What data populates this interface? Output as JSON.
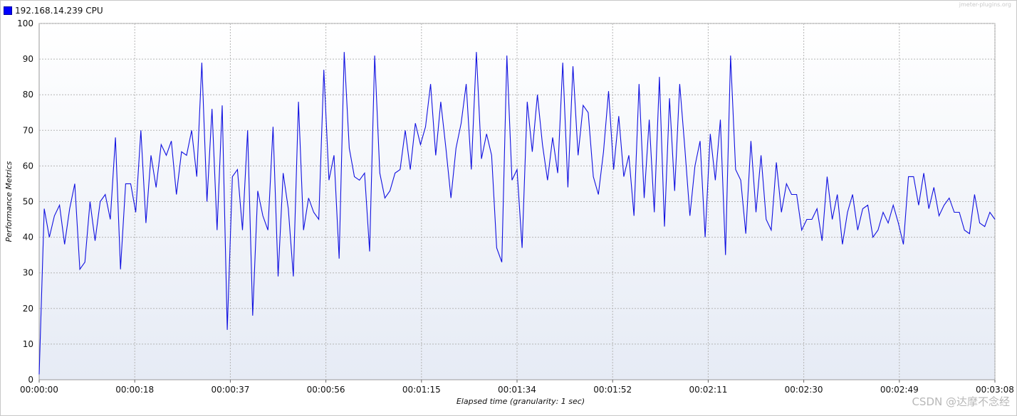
{
  "watermark_top": "jmeter-plugins.org",
  "watermark_bottom": "CSDN @达摩不念经",
  "chart_data": {
    "type": "line",
    "ylabel": "Performance Metrics",
    "xlabel": "Elapsed time (granularity: 1 sec)",
    "ylim": [
      0,
      100
    ],
    "yticks": [
      0,
      10,
      20,
      30,
      40,
      50,
      60,
      70,
      80,
      90,
      100
    ],
    "xlim_seconds": [
      0,
      188
    ],
    "xtick_labels": [
      "00:00:00",
      "00:00:18",
      "00:00:37",
      "00:00:56",
      "00:01:15",
      "00:01:34",
      "00:01:52",
      "00:02:11",
      "00:02:30",
      "00:02:49",
      "00:03:08"
    ],
    "grid": true,
    "legend_position": "top-left",
    "series": [
      {
        "name": "192.168.14.239 CPU",
        "color": "#0000ff",
        "values": [
          1.5,
          48,
          40,
          46,
          49,
          38,
          48,
          55,
          31,
          33,
          50,
          39,
          50,
          52,
          45,
          68,
          31,
          55,
          55,
          47,
          70,
          44,
          63,
          54,
          66,
          63,
          67,
          52,
          64,
          63,
          70,
          57,
          89,
          50,
          76,
          42,
          77,
          14,
          57,
          59,
          42,
          70,
          18,
          53,
          46,
          42,
          71,
          29,
          58,
          48,
          29,
          78,
          42,
          51,
          47,
          45,
          87,
          56,
          63,
          34,
          92,
          65,
          57,
          56,
          58,
          36,
          91,
          58,
          51,
          53,
          58,
          59,
          70,
          59,
          72,
          66,
          71,
          83,
          63,
          78,
          65,
          51,
          65,
          72,
          83,
          59,
          92,
          62,
          69,
          63,
          37,
          33,
          91,
          56,
          59,
          37,
          78,
          64,
          80,
          66,
          56,
          68,
          58,
          89,
          54,
          88,
          63,
          77,
          75,
          57,
          52,
          64,
          81,
          59,
          74,
          57,
          63,
          46,
          83,
          51,
          73,
          47,
          85,
          43,
          79,
          53,
          83,
          65,
          46,
          60,
          67,
          40,
          69,
          56,
          73,
          35,
          91,
          59,
          56,
          41,
          67,
          47,
          63,
          45,
          42,
          61,
          47,
          55,
          52,
          52,
          42,
          45,
          45,
          48,
          39,
          57,
          45,
          52,
          38,
          47,
          52,
          42,
          48,
          49,
          40,
          42,
          47,
          44,
          49,
          44,
          38,
          57,
          57,
          49,
          58,
          48,
          54,
          46,
          49,
          51,
          47,
          47,
          42,
          41,
          52,
          44,
          43,
          47,
          45
        ]
      }
    ]
  }
}
